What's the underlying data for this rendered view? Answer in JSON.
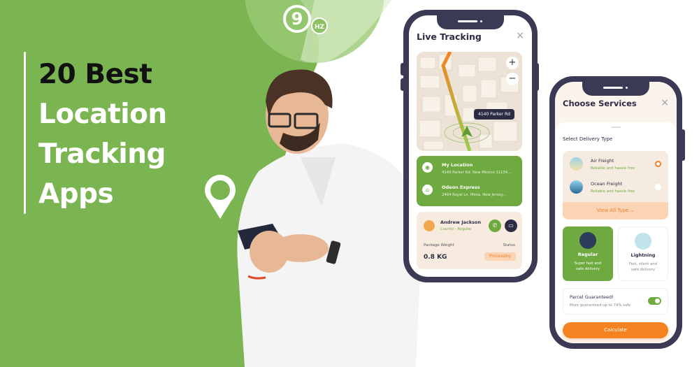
{
  "colors": {
    "brand_green": "#7ab552",
    "ui_green": "#6eaa3f",
    "orange": "#f58220",
    "phone_frame": "#3b3a55"
  },
  "headline": {
    "line1": "20 Best",
    "line2": "Location",
    "line3": "Tracking",
    "line4": "Apps"
  },
  "logo": {
    "mark": "9",
    "badge": "HZ"
  },
  "live_tracking": {
    "title": "Live Tracking",
    "close_icon": "×",
    "zoom_in": "+",
    "zoom_out": "−",
    "map_tooltip": "4140 Parker Rd",
    "my_location": {
      "label": "My Location",
      "address": "4140 Parker Rd, New Mexico 31134..."
    },
    "destination": {
      "label": "Odeon Express",
      "address": "2464 Royal Ln. Mesa, New Jersey..."
    },
    "courier": {
      "name": "Andrew Jackson",
      "type": "Courier - Regular",
      "package_weight_label": "Package Weight",
      "package_weight_value": "0.8 KG",
      "status_label": "Status",
      "status_value": "Processing"
    }
  },
  "choose_services": {
    "title": "Choose Services",
    "close_icon": "×",
    "section_label": "Select Delivery Type",
    "delivery_types": [
      {
        "name": "Air Freight",
        "subtitle": "Reliable and hassle free",
        "selected": true
      },
      {
        "name": "Ocean Freight",
        "subtitle": "Reliable and hassle free",
        "selected": false
      }
    ],
    "view_all": "View All Type",
    "services": [
      {
        "name": "Regular",
        "desc1": "Super fast and",
        "desc2": "safe delivery",
        "selected": true
      },
      {
        "name": "Lightning",
        "desc1": "Fast, silent and",
        "desc2": "safe delivery",
        "selected": false
      }
    ],
    "parcel": {
      "title": "Parcel Guaranteed!",
      "subtitle": "More guaranteed up to 74% safe",
      "enabled": true
    },
    "calculate": "Calculate"
  }
}
